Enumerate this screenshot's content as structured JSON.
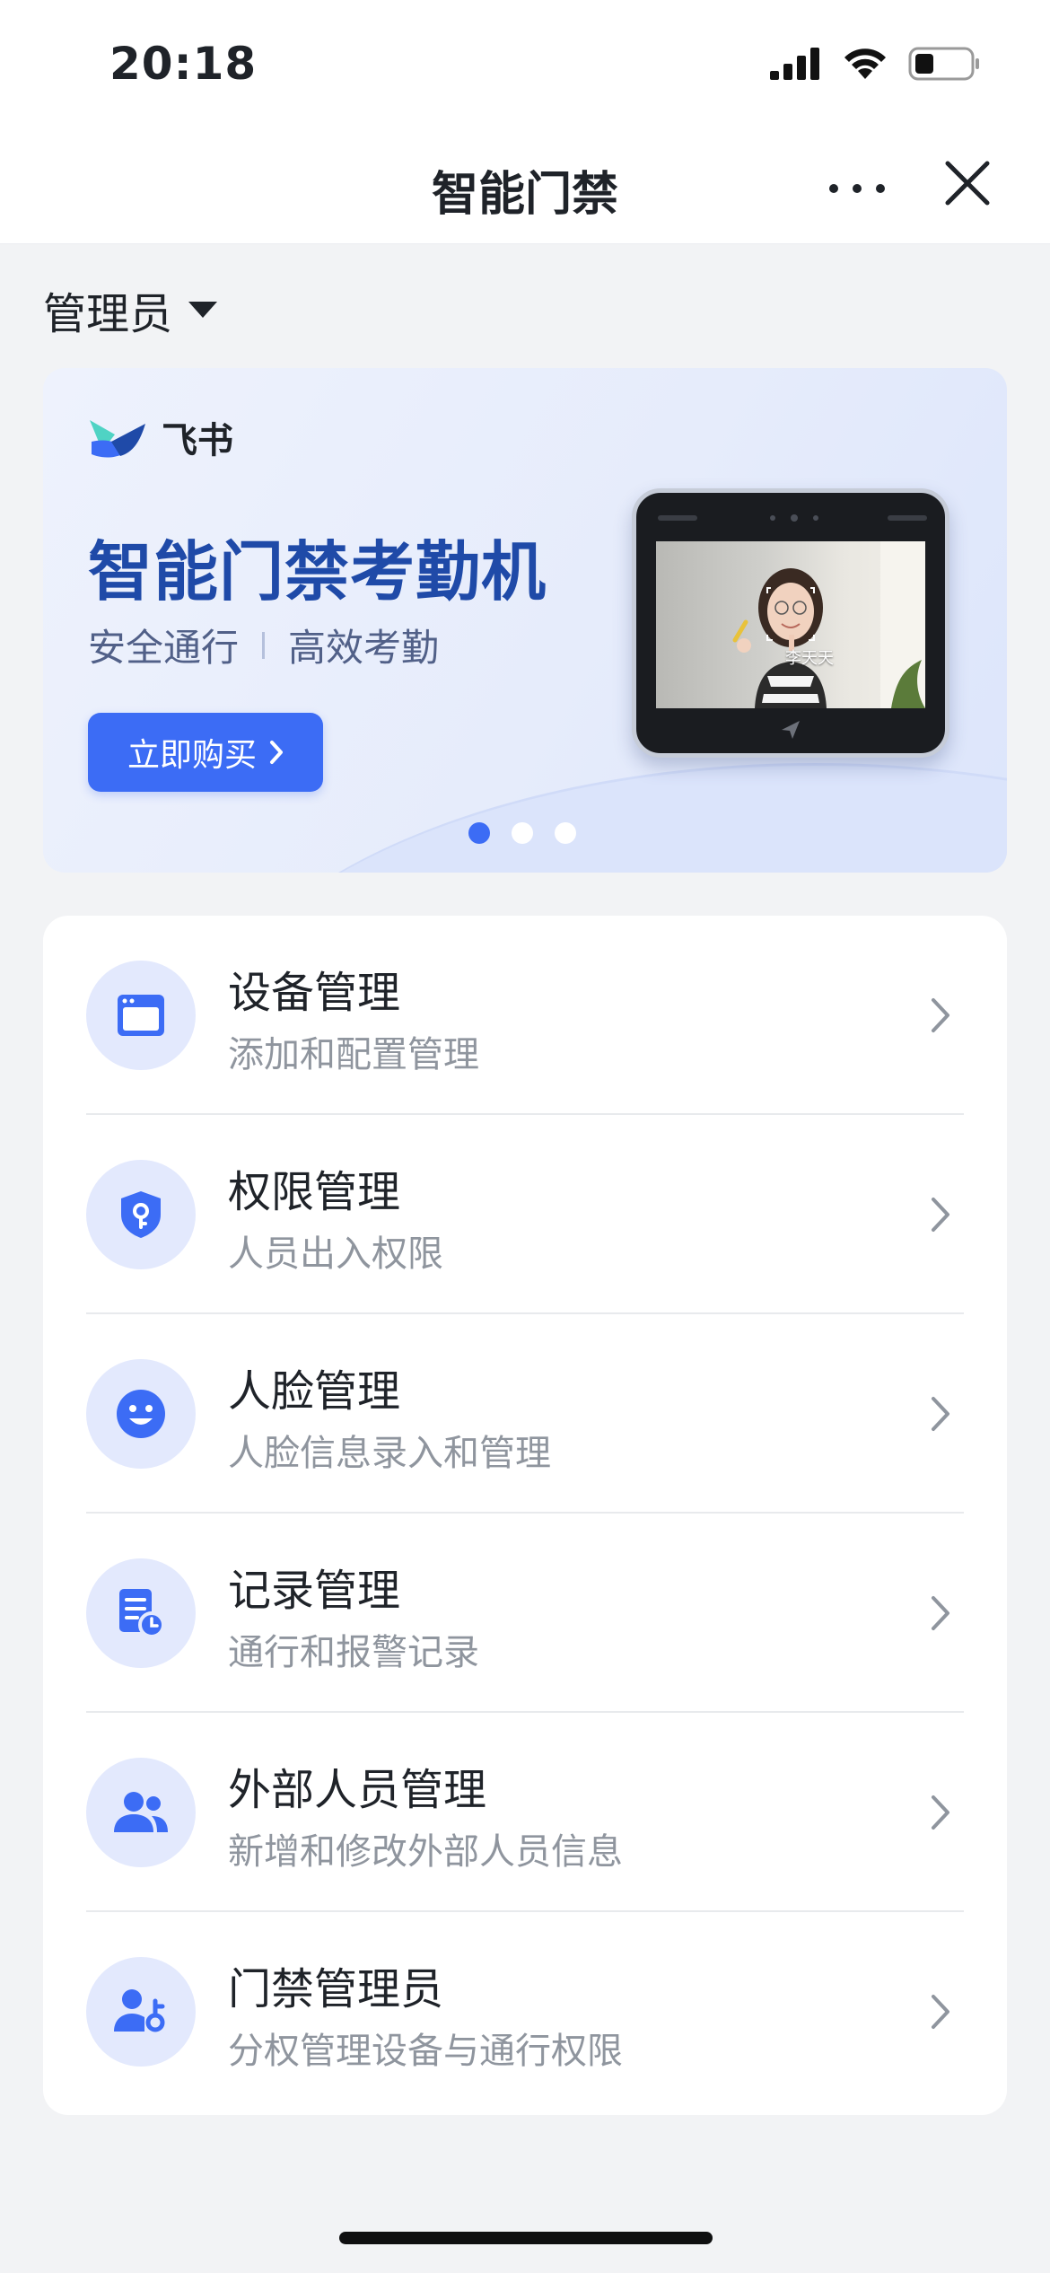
{
  "status_bar": {
    "time": "20:18"
  },
  "nav": {
    "title": "智能门禁"
  },
  "role_selector": {
    "label": "管理员"
  },
  "banner": {
    "brand": "飞书",
    "title": "智能门禁考勤机",
    "subtitle_left": "安全通行",
    "subtitle_right": "高效考勤",
    "buy_label": "立即购买",
    "device_name": "李天天",
    "carousel": {
      "count": 3,
      "active_index": 0
    }
  },
  "menu": {
    "items": [
      {
        "title": "设备管理",
        "desc": "添加和配置管理",
        "icon": "device-window-icon"
      },
      {
        "title": "权限管理",
        "desc": "人员出入权限",
        "icon": "shield-key-icon"
      },
      {
        "title": "人脸管理",
        "desc": "人脸信息录入和管理",
        "icon": "smiley-face-icon"
      },
      {
        "title": "记录管理",
        "desc": "通行和报警记录",
        "icon": "document-clock-icon"
      },
      {
        "title": "外部人员管理",
        "desc": "新增和修改外部人员信息",
        "icon": "people-icon"
      },
      {
        "title": "门禁管理员",
        "desc": "分权管理设备与通行权限",
        "icon": "person-key-icon"
      }
    ]
  },
  "colors": {
    "accent": "#3C6CF5",
    "banner_title": "#1F4AA8",
    "icon_bg": "#E3E9FD"
  }
}
